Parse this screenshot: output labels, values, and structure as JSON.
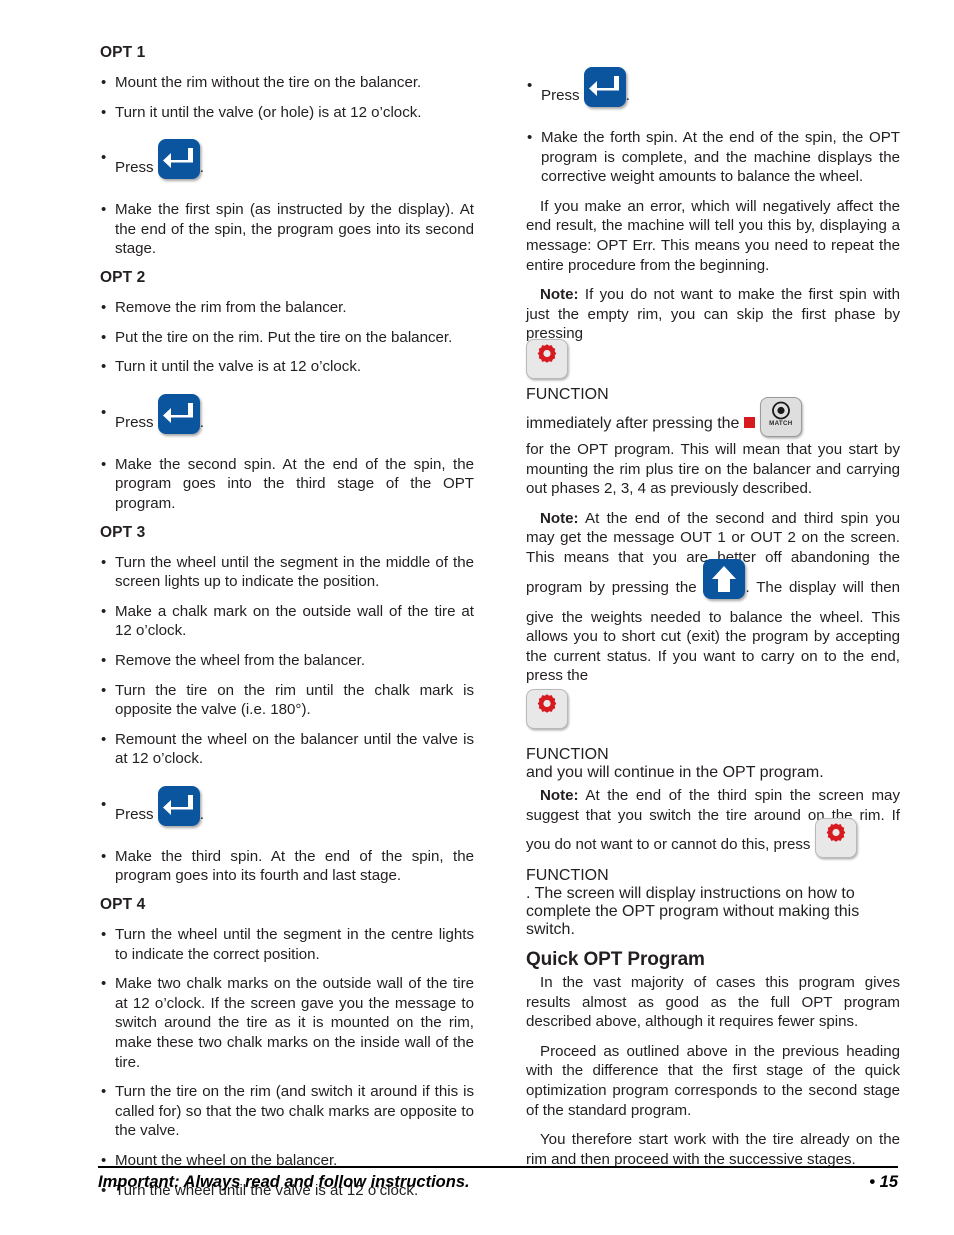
{
  "document": {
    "page_number": "15",
    "footer_note": "Important: Always read and follow instructions.",
    "footer_page_marker": "• 15"
  },
  "icons": {
    "enter": "enter-key-icon",
    "up_arrow": "up-arrow-key-icon",
    "function": "function-gear-icon",
    "match": "match-target-icon",
    "function_label": "FUNCTION",
    "match_label": "MATCH"
  },
  "colors": {
    "button_blue": "#0b559e",
    "function_red": "#d71920",
    "button_gray": "#e8e8e8",
    "text": "#231f20"
  },
  "left_column": {
    "opt1": {
      "heading": "OPT 1",
      "bullets": [
        "Mount the rim without the tire on the balancer.",
        "Turn it until the valve (or hole) is at 12 o’clock."
      ],
      "press_label": "Press",
      "press_suffix": ".",
      "after_press_bullet": "Make the first spin (as instructed by the display). At the end of the spin, the program goes into its second stage."
    },
    "opt2": {
      "heading": "OPT 2",
      "bullets": [
        "Remove the rim from the balancer.",
        "Put the tire on the rim. Put the tire on the balancer.",
        "Turn it until the valve is at 12 o’clock."
      ],
      "press_label": "Press",
      "press_suffix": ".",
      "after_press_bullet": "Make the second spin. At the end of the spin, the program goes into the third stage of the OPT program."
    },
    "opt3": {
      "heading": "OPT 3",
      "bullets": [
        "Turn the wheel until the segment in the middle of the screen lights up to indicate the position.",
        "Make a chalk mark on the outside wall of the tire at 12 o’clock.",
        "Remove the wheel from the balancer.",
        "Turn the tire on the rim until the chalk mark is opposite the valve (i.e. 180°).",
        "Remount the wheel on the balancer until the valve is at 12 o’clock."
      ],
      "press_label": "Press",
      "press_suffix": ".",
      "after_press_bullet": "Make the third spin. At the end of the spin, the program goes into its fourth and last stage."
    },
    "opt4": {
      "heading": "OPT 4",
      "bullets": [
        "Turn the wheel until the segment in the centre lights to indicate the correct position.",
        "Make two chalk marks on the outside wall of the tire at 12 o’clock. If the screen gave you the message to switch around the tire as it is mounted on the rim, make these two chalk marks on the inside wall of the tire.",
        "Turn the tire on the rim (and switch it around if this is called for) so that the two chalk marks are opposite to the valve.",
        "Mount the wheel on the balancer.",
        "Turn the wheel until the valve is at 12 o’clock."
      ]
    }
  },
  "right_column": {
    "press_label": "Press",
    "press_suffix": ".",
    "forth_spin_bullet": "Make the forth spin. At the end of the spin, the OPT program is complete, and the machine displays the corrective weight amounts to balance the wheel.",
    "error_paragraph": "If you make an error, which will negatively affect the end result, the machine will tell you this by, displaying a message: OPT Err. This means you need to repeat the entire procedure from the beginning.",
    "note1": {
      "label": "Note:",
      "text_before_function": " If you do not want to make the first spin with just the empty rim, you can skip the first phase by pressing ",
      "text_between": " immediately after pressing the ",
      "text_after_match": "for the OPT program. This will mean that you start by mounting the rim plus tire on the balancer and carrying out phases 2, 3, 4 as previously described."
    },
    "note2": {
      "label": "Note:",
      "text_before_up": " At the end of the second and third spin you may get the message OUT 1 or OUT 2 on the screen. This means that you are better off abandoning the program by pressing the ",
      "text_after_up": ". The display will then give the weights needed to balance the wheel. This allows you to short cut (exit) the program by accepting the current status. If you want to carry on to the end, press the ",
      "text_after_function": " and you will continue in the OPT program."
    },
    "note3": {
      "label": "Note:",
      "text_before_function": " At the end of the third spin the screen may suggest that you switch the tire around on the rim. If you do not want to or cannot do this, press ",
      "text_after_function": ". The screen will display instructions on how to complete the OPT program without making this switch."
    },
    "quick_opt": {
      "heading": "Quick OPT Program",
      "paragraphs": [
        "In the vast majority of cases this program gives results almost as good as the full OPT program described above, although it requires fewer spins.",
        "Proceed as outlined above in the previous heading with the difference that the first stage of the quick optimization program corresponds to the second stage of the standard program.",
        "You therefore start work with the tire already on the rim and then proceed with the successive stages."
      ]
    }
  }
}
